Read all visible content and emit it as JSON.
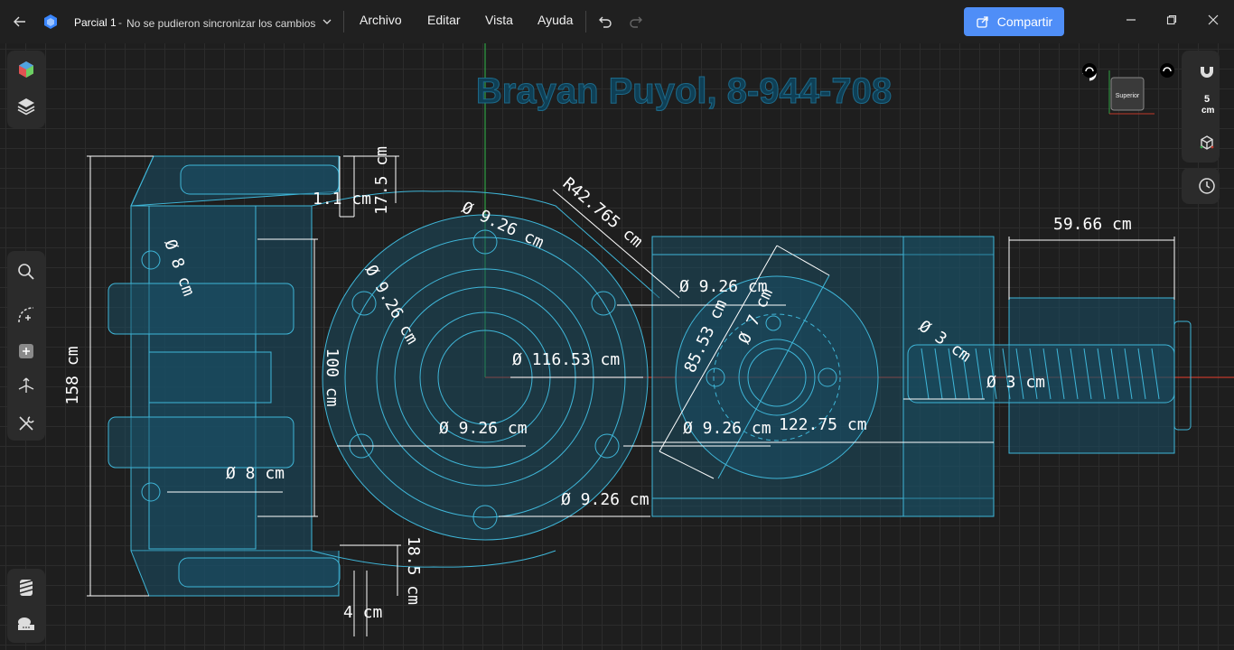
{
  "titlebar": {
    "doc_name": "Parcial 1",
    "separator": "-",
    "sync_status": "No se pudieron sincronizar los cambios",
    "menus": [
      "Archivo",
      "Editar",
      "Vista",
      "Ayuda"
    ],
    "share_label": "Compartir"
  },
  "canvas": {
    "watermark": "Brayan Puyol, 8-944-708",
    "view_cube_label": "Superior",
    "scale_value": "5",
    "scale_unit": "cm"
  },
  "dimensions": {
    "d_left_height": "158 cm",
    "d_inner_height": "100 cm",
    "d_top_width": "1.1 cm",
    "d_top_height": "17.5 cm",
    "d_bottom_height": "18.5 cm",
    "d_bottom_width": "4 cm",
    "d_hole_8_top": "Ø 8 cm",
    "d_hole_8_bottom": "Ø 8 cm",
    "d_926_a": "Ø 9.26 cm",
    "d_926_b": "Ø 9.26 cm",
    "d_926_c": "Ø 9.26 cm",
    "d_926_d": "Ø 9.26 cm",
    "d_926_e": "Ø 9.26 cm",
    "d_926_f": "Ø 9.26 cm",
    "d_radius": "R42.765 cm",
    "d_big_dia": "Ø 116.53 cm",
    "d_85": "85.53 cm",
    "d_7": "Ø 7 cm",
    "d_3_a": "Ø 3 cm",
    "d_3_b": "Ø 3 cm",
    "d_122": "122.75 cm",
    "d_59": "59.66 cm"
  },
  "colors": {
    "accent": "#4f8ef7",
    "sketch": "#3fb6d8",
    "fill": "#1a4f66",
    "axis_red": "#c0392b",
    "axis_green": "#2ea043"
  }
}
